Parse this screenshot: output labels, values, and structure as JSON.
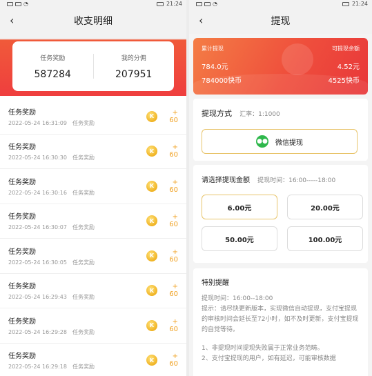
{
  "left": {
    "status": {
      "time": "21:24"
    },
    "nav": {
      "back_icon": "back-arrow-icon",
      "title": "收支明细"
    },
    "summary": {
      "task_reward_label": "任务奖励",
      "task_reward_value": "587284",
      "my_share_label": "我的分佣",
      "my_share_value": "207951"
    },
    "records": [
      {
        "title": "任务奖励",
        "time": "2022-05-24 16:31:09",
        "type": "任务奖励",
        "amount": "+ 60"
      },
      {
        "title": "任务奖励",
        "time": "2022-05-24 16:30:30",
        "type": "任务奖励",
        "amount": "+ 60"
      },
      {
        "title": "任务奖励",
        "time": "2022-05-24 16:30:16",
        "type": "任务奖励",
        "amount": "+ 60"
      },
      {
        "title": "任务奖励",
        "time": "2022-05-24 16:30:07",
        "type": "任务奖励",
        "amount": "+ 60"
      },
      {
        "title": "任务奖励",
        "time": "2022-05-24 16:30:05",
        "type": "任务奖励",
        "amount": "+ 60"
      },
      {
        "title": "任务奖励",
        "time": "2022-05-24 16:29:43",
        "type": "任务奖励",
        "amount": "+ 60"
      },
      {
        "title": "任务奖励",
        "time": "2022-05-24 16:29:28",
        "type": "任务奖励",
        "amount": "+ 60"
      },
      {
        "title": "任务奖励",
        "time": "2022-05-24 16:29:18",
        "type": "任务奖励",
        "amount": "+ 60"
      }
    ]
  },
  "right": {
    "status": {
      "time": "21:24"
    },
    "nav": {
      "title": "提现"
    },
    "banner": {
      "total_label": "累计提现",
      "available_label": "可提现余额",
      "total_yuan": "784.0元",
      "available_yuan": "4.52元",
      "total_coins": "784000快币",
      "available_coins": "4525快币"
    },
    "method": {
      "title": "提现方式",
      "rate": "汇率：1:1000",
      "wechat_label": "微信提现"
    },
    "amount": {
      "title": "请选择提现金额",
      "time": "提现时间：16:00-----18:00",
      "options": [
        "6.00元",
        "20.00元",
        "50.00元",
        "100.00元"
      ],
      "selected_index": 0
    },
    "notice": {
      "title": "特别提醒",
      "line1": "提现时间：16:00--18:00",
      "line2": "提示：请尽快更新版本，实现微信自动提现，支付宝提现的审核时间会延长至72小时，如不及时更新，支付宝提现的自觉等待。",
      "line3": "1、非提现时间提现失败属于正常业务范畴。",
      "line4": "2、支付宝提现的用户，如有延迟，可能审核数据"
    }
  },
  "colors": {
    "accent_red": "#ef3e3e",
    "accent_orange": "#f47d45",
    "coin_gold": "#f0b323",
    "amount_text": "#f0a020",
    "wechat_green": "#2fb84c",
    "selected_border": "#e8c46a"
  }
}
